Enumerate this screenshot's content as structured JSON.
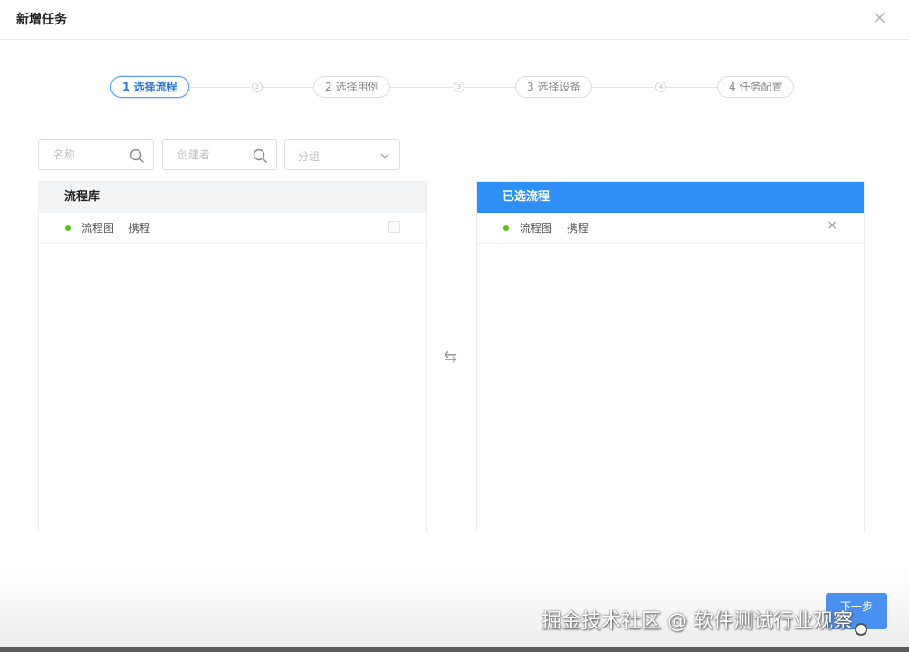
{
  "dialog": {
    "title": "新增任务",
    "close_glyph": "×"
  },
  "steps": [
    {
      "label": "1 选择流程",
      "active": true
    },
    {
      "label": "2 选择用例",
      "active": false
    },
    {
      "label": "3 选择设备",
      "active": false
    },
    {
      "label": "4 任务配置",
      "active": false
    }
  ],
  "step_dots": [
    "2",
    "3",
    "4"
  ],
  "filters": {
    "name_placeholder": "名称",
    "creator_placeholder": "创建者",
    "group_placeholder": "分组"
  },
  "library": {
    "title": "流程库",
    "items": [
      {
        "name": "流程图",
        "creator": "携程",
        "status_color": "#52c41a"
      }
    ]
  },
  "selected": {
    "title": "已选流程",
    "items": [
      {
        "name": "流程图",
        "creator": "携程",
        "status_color": "#52c41a"
      }
    ],
    "remove_glyph": "×"
  },
  "transfer_glyph": "⇆",
  "next_button": "下一步",
  "watermark": "掘金技术社区 @ 软件测试行业观察",
  "colors": {
    "accent": "#2e8ff7",
    "status_green": "#52c41a"
  }
}
